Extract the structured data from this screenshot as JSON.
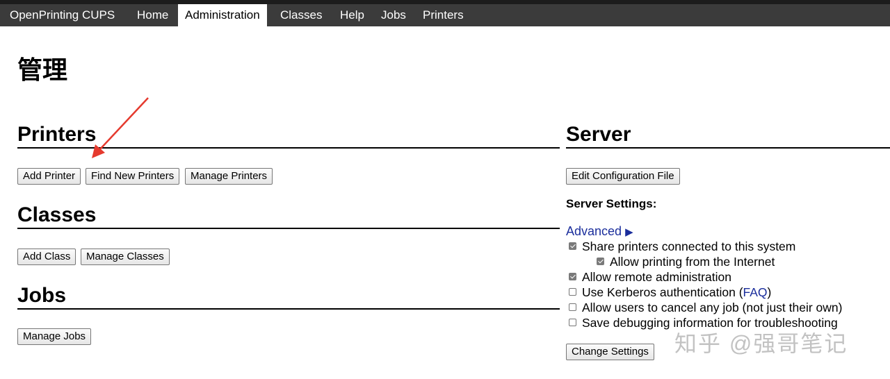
{
  "nav": {
    "brand": "OpenPrinting CUPS",
    "home": "Home",
    "administration": "Administration",
    "classes": "Classes",
    "help": "Help",
    "jobs": "Jobs",
    "printers": "Printers"
  },
  "page_title": "管理",
  "printers": {
    "heading": "Printers",
    "add_printer": "Add Printer",
    "find_new_printers": "Find New Printers",
    "manage_printers": "Manage Printers"
  },
  "classes": {
    "heading": "Classes",
    "add_class": "Add Class",
    "manage_classes": "Manage Classes"
  },
  "jobs": {
    "heading": "Jobs",
    "manage_jobs": "Manage Jobs"
  },
  "server": {
    "heading": "Server",
    "edit_config": "Edit Configuration File",
    "settings_heading": "Server Settings:",
    "advanced_label": "Advanced",
    "advanced_icon": "triangle-right-icon",
    "options": [
      {
        "label": "Share printers connected to this system",
        "checked": true
      },
      {
        "label": "Allow printing from the Internet",
        "checked": true
      },
      {
        "label": "Allow remote administration",
        "checked": true
      },
      {
        "label": "Use Kerberos authentication",
        "checked": false
      },
      {
        "label": "Allow users to cancel any job (not just their own)",
        "checked": false
      },
      {
        "label": "Save debugging information for troubleshooting",
        "checked": false
      }
    ],
    "kerberos_open_paren": "(",
    "kerberos_faq": "FAQ",
    "kerberos_close_paren": ")",
    "change_settings": "Change Settings"
  },
  "watermark": "知乎 @强哥笔记",
  "colors": {
    "nav_bg": "#3b3b3b",
    "link": "#1b2e9c",
    "annotation_arrow": "#e53a2e"
  }
}
